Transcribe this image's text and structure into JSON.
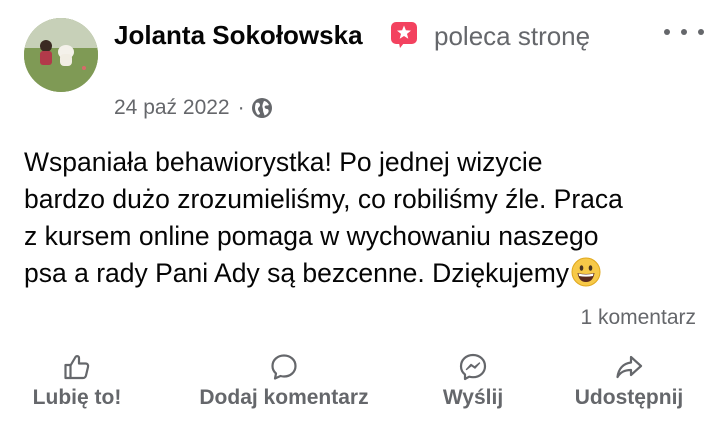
{
  "post": {
    "author": "Jolanta Sokołowska",
    "action_text": "poleca stronę",
    "date": "24 paź 2022",
    "separator": "·",
    "privacy_icon": "globe-icon",
    "body_text": "Wspaniała behawiorystka! Po jednej wizycie\nbardzo dużo zrozumieliśmy, co robiliśmy źle. Praca\nz kursem online pomaga w wychowaniu naszego\npsa a rady Pani Ady są bezcenne. Dziękujemy",
    "body_emoji": "grinning-face-emoji",
    "comments_count": "1 komentarz"
  },
  "actions": {
    "like": "Lubię to!",
    "comment": "Dodaj komentarz",
    "send": "Wyślij",
    "share": "Udostępnij"
  },
  "colors": {
    "text_primary": "#050505",
    "text_secondary": "#65676b",
    "recommend_badge": "#f3425f",
    "background": "#ffffff"
  }
}
